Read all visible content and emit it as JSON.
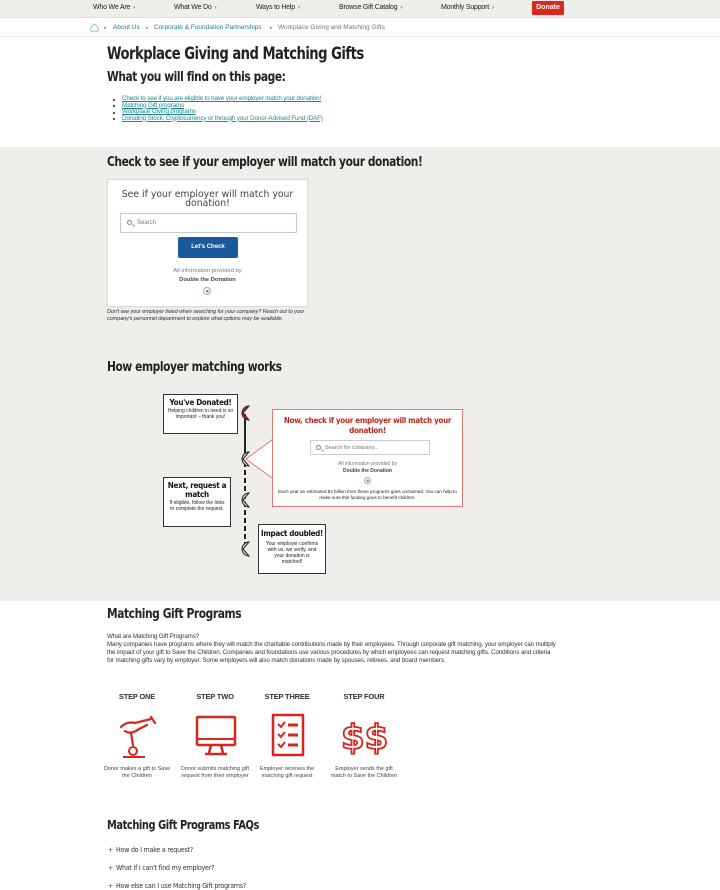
{
  "topnav": {
    "items": [
      {
        "label": "Who We Are"
      },
      {
        "label": "What We Do"
      },
      {
        "label": "Ways to Help"
      },
      {
        "label": "Browse Gift Catalog"
      },
      {
        "label": "Monthly Support"
      }
    ],
    "donate_label": "Donate",
    "chevron": "›"
  },
  "breadcrumb": {
    "home_icon": "home-icon",
    "items": [
      {
        "label": "About Us"
      },
      {
        "label": "Corporate & Foundation Partnerships"
      },
      {
        "label": "Workplace Giving and Matching Gifts"
      }
    ],
    "separator": "▸"
  },
  "page": {
    "title": "Workplace Giving and Matching Gifts",
    "toc_heading": "What you will find on this page:",
    "toc": [
      "Check to see if you are eligible to have your employer match your donation!",
      "Matching Gift programs",
      "Workplace Giving programs",
      "Donating Stock, Cryptocurrency or through your Donor-Advised Fund (DAF)"
    ]
  },
  "check_section": {
    "heading": "Check to see if your employer will match your donation!",
    "widget": {
      "title": "See if your employer will match your donation!",
      "search_placeholder": "Search",
      "button_label": "Let's Check",
      "info": "All information provided by",
      "provider": "Double the Donation"
    },
    "note": "Don't see your employer listed when searching for your company? Reach out to your company's personnel department to explore what options may be available."
  },
  "how_section": {
    "heading": "How employer matching works",
    "step1": {
      "title": "You've Donated!",
      "body": "Helping children in need is so important – thank you!"
    },
    "step2": {
      "title": "Now, check if your employer will match your donation!",
      "search_placeholder": "Search for company...",
      "info": "All information provided by",
      "provider": "Double the Donation",
      "footer": "Each year an estimated $4 billion from these programs goes unclaimed. You can help to make sure this funding goes to benefit children."
    },
    "step3": {
      "title": "Next, request a match",
      "body": "If eligible, follow the links to complete the request."
    },
    "step4": {
      "title": "Impact doubled!",
      "body": "Your employer confirms with us, we verify, and your donation is matched!"
    }
  },
  "matching_section": {
    "heading": "Matching Gift Programs",
    "question": "What are Matching Gift Programs?",
    "body": "Many companies have programs where they will match the charitable contributions made by their employees. Through corporate gift matching, your employer can multiply the impact of your gift to Save the Children. Companies and foundations use various procedures by which employees can request matching gifts. Conditions and criteria for matching gifts vary by employer. Some employers will also match donations made by spouses, retirees, and board members.",
    "steps": [
      {
        "label": "STEP ONE",
        "icon": "hand-coin-icon",
        "desc": "Donor makes a gift to Save the Children"
      },
      {
        "label": "STEP TWO",
        "icon": "monitor-icon",
        "desc": "Donor submits matching gift request from their employer"
      },
      {
        "label": "STEP THREE",
        "icon": "checklist-icon",
        "desc": "Employer receives the matching gift request"
      },
      {
        "label": "STEP FOUR",
        "icon": "dollar-signs-icon",
        "desc": "Employer sends the gift match to Save the Children"
      }
    ]
  },
  "faq_section": {
    "heading": "Matching Gift Programs FAQs",
    "items": [
      {
        "question": "How do I make a request?"
      },
      {
        "question": "What if I can't find my employer?"
      },
      {
        "question": "How else can I use Matching Gift programs?"
      }
    ],
    "expand_glyph": "+"
  },
  "colors": {
    "brand_red": "#da291c",
    "link_teal": "#1a8a8f",
    "button_blue": "#1a5a9a",
    "band_gray": "#efeeea"
  }
}
